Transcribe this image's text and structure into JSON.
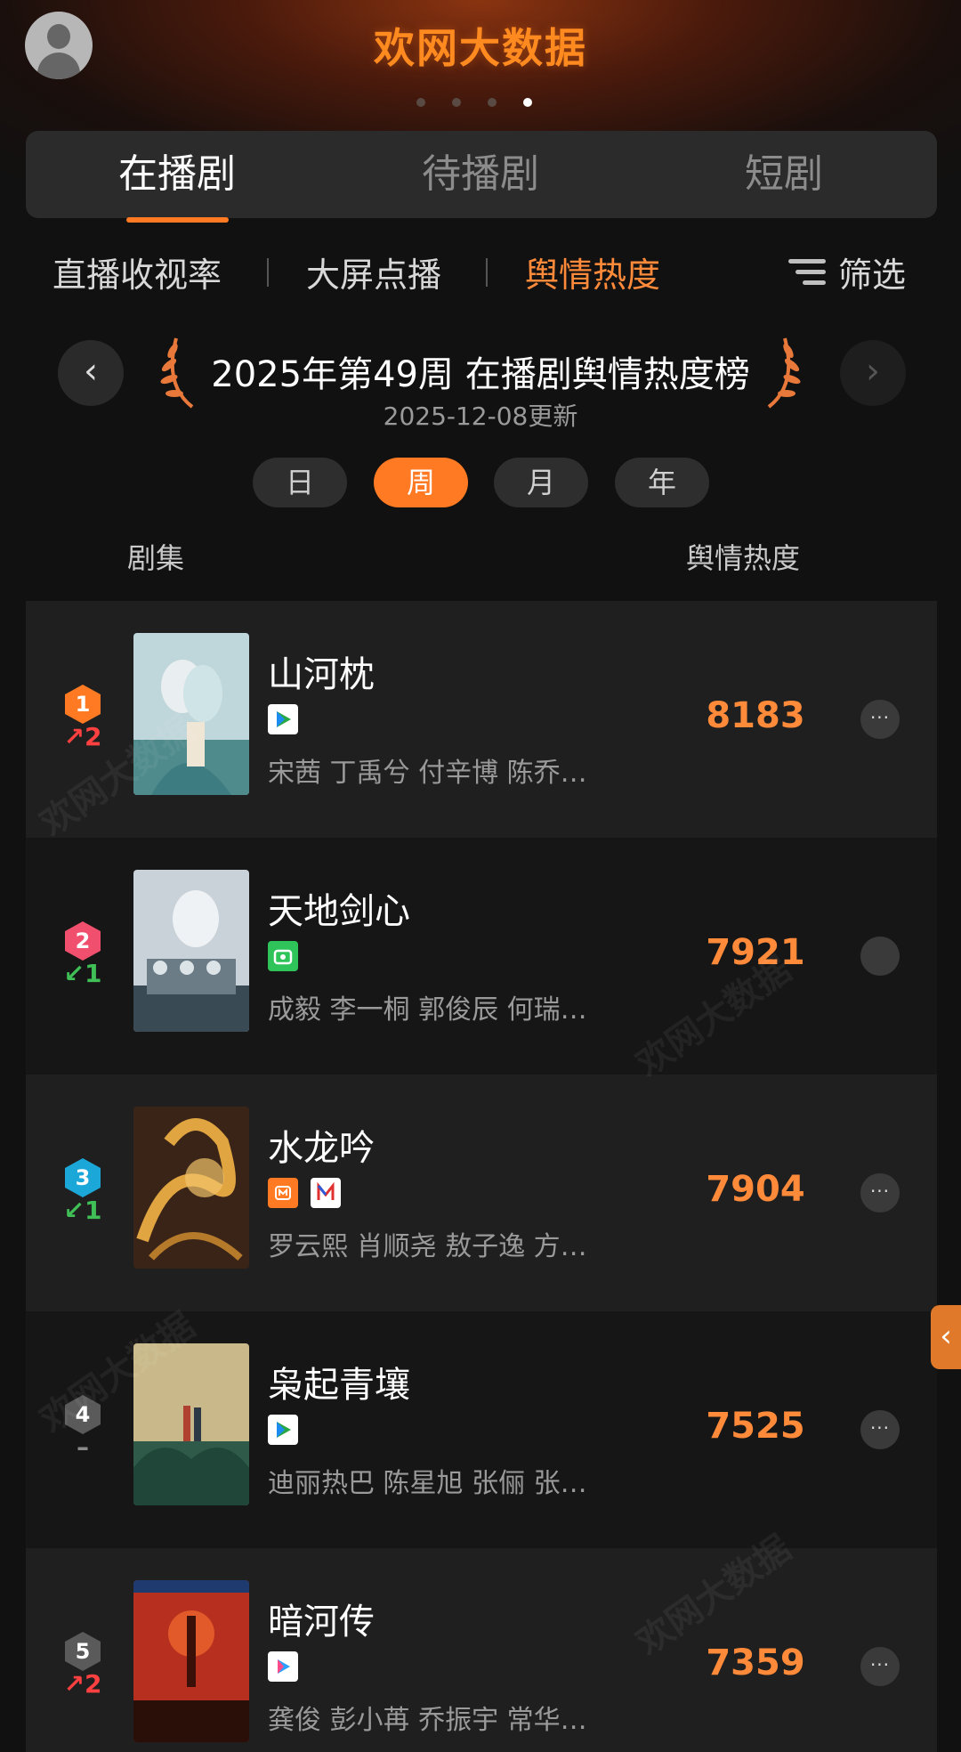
{
  "header": {
    "logo_text": "欢网大数据",
    "carousel_dots": 4,
    "active_dot": 4
  },
  "main_tabs": [
    {
      "label": "在播剧",
      "active": true
    },
    {
      "label": "待播剧",
      "active": false
    },
    {
      "label": "短剧",
      "active": false
    }
  ],
  "sub_tabs": [
    {
      "label": "直播收视率",
      "active": false
    },
    {
      "label": "大屏点播",
      "active": false
    },
    {
      "label": "舆情热度",
      "active": true
    }
  ],
  "filter_label": "筛选",
  "nav": {
    "prev_symbol": "‹",
    "next_symbol": "›"
  },
  "ranking": {
    "title": "2025年第49周 在播剧舆情热度榜",
    "updated": "2025-12-08更新"
  },
  "periods": [
    {
      "label": "日",
      "active": false
    },
    {
      "label": "周",
      "active": true
    },
    {
      "label": "月",
      "active": false
    },
    {
      "label": "年",
      "active": false
    }
  ],
  "columns": {
    "series": "剧集",
    "metric": "舆情热度"
  },
  "items": [
    {
      "rank": "1",
      "change": "↗2",
      "change_dir": "up",
      "title": "山河枕",
      "platforms": [
        "tencent-video-icon"
      ],
      "cast": "宋茜 丁禹兮 付辛博 陈乔…",
      "score": "8183",
      "badge_color": "#ff7a22",
      "more": "···"
    },
    {
      "rank": "2",
      "change": "↙1",
      "change_dir": "down",
      "title": "天地剑心",
      "platforms": [
        "iqiyi-icon"
      ],
      "cast": "成毅 李一桐 郭俊辰 何瑞…",
      "score": "7921",
      "badge_color": "#f0506e",
      "more": ""
    },
    {
      "rank": "3",
      "change": "↙1",
      "change_dir": "down",
      "title": "水龙吟",
      "platforms": [
        "mango-tv-icon",
        "migu-icon"
      ],
      "cast": "罗云熙 肖顺尧 敖子逸 方…",
      "score": "7904",
      "badge_color": "#1ba7d8",
      "more": "···"
    },
    {
      "rank": "4",
      "change": "–",
      "change_dir": "flat",
      "title": "枭起青壤",
      "platforms": [
        "tencent-video-icon"
      ],
      "cast": "迪丽热巴 陈星旭 张俪 张…",
      "score": "7525",
      "badge_color": "#5a5a5a",
      "more": "···"
    },
    {
      "rank": "5",
      "change": "↗2",
      "change_dir": "up",
      "title": "暗河传",
      "platforms": [
        "youku-icon"
      ],
      "cast": "龚俊 彭小苒 乔振宇 常华…",
      "score": "7359",
      "badge_color": "#5a5a5a",
      "more": "···"
    }
  ],
  "side_tab_symbol": "‹",
  "watermark": "欢网大数据",
  "colors": {
    "accent": "#ff7a22",
    "score": "#ff8a3a",
    "background": "#111111"
  }
}
